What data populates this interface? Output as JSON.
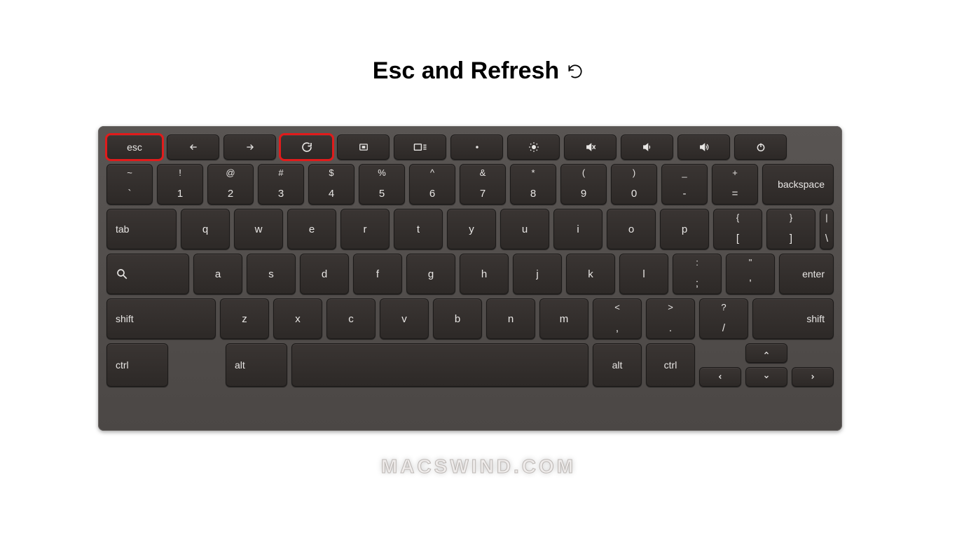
{
  "title_text": "Esc and Refresh",
  "watermark_text": "MACSWIND.COM",
  "highlighted_keys": [
    "esc",
    "refresh"
  ],
  "function_row": [
    {
      "id": "esc",
      "kind": "text",
      "label": "esc",
      "highlight": true
    },
    {
      "id": "back",
      "kind": "icon",
      "icon": "arrow-left",
      "highlight": false
    },
    {
      "id": "forward",
      "kind": "icon",
      "icon": "arrow-right",
      "highlight": false
    },
    {
      "id": "refresh",
      "kind": "icon",
      "icon": "refresh",
      "highlight": true
    },
    {
      "id": "fullscreen",
      "kind": "icon",
      "icon": "fullscreen",
      "highlight": false
    },
    {
      "id": "overview",
      "kind": "icon",
      "icon": "overview",
      "highlight": false
    },
    {
      "id": "brightness-down",
      "kind": "icon",
      "icon": "brightness-down",
      "highlight": false
    },
    {
      "id": "brightness-up",
      "kind": "icon",
      "icon": "brightness-up",
      "highlight": false
    },
    {
      "id": "mute",
      "kind": "icon",
      "icon": "mute",
      "highlight": false
    },
    {
      "id": "volume-down",
      "kind": "icon",
      "icon": "volume-down",
      "highlight": false
    },
    {
      "id": "volume-up",
      "kind": "icon",
      "icon": "volume-up",
      "highlight": false
    },
    {
      "id": "power",
      "kind": "icon",
      "icon": "power",
      "highlight": false
    }
  ],
  "number_row": [
    {
      "upper": "~",
      "lower": "`"
    },
    {
      "upper": "!",
      "lower": "1"
    },
    {
      "upper": "@",
      "lower": "2"
    },
    {
      "upper": "#",
      "lower": "3"
    },
    {
      "upper": "$",
      "lower": "4"
    },
    {
      "upper": "%",
      "lower": "5"
    },
    {
      "upper": "^",
      "lower": "6"
    },
    {
      "upper": "&",
      "lower": "7"
    },
    {
      "upper": "*",
      "lower": "8"
    },
    {
      "upper": "(",
      "lower": "9"
    },
    {
      "upper": ")",
      "lower": "0"
    },
    {
      "upper": "_",
      "lower": "-"
    },
    {
      "upper": "+",
      "lower": "="
    }
  ],
  "backspace_label": "backspace",
  "qwerty_row": {
    "tab_label": "tab",
    "letters": [
      "q",
      "w",
      "e",
      "r",
      "t",
      "y",
      "u",
      "i",
      "o",
      "p"
    ],
    "bracket_l": {
      "upper": "{",
      "lower": "["
    },
    "bracket_r": {
      "upper": "}",
      "lower": "]"
    },
    "bslash": {
      "upper": "|",
      "lower": "\\"
    }
  },
  "home_row": {
    "letters": [
      "a",
      "s",
      "d",
      "f",
      "g",
      "h",
      "j",
      "k",
      "l"
    ],
    "semicolon": {
      "upper": ":",
      "lower": ";"
    },
    "quote": {
      "upper": "\"",
      "lower": "'"
    },
    "enter_label": "enter"
  },
  "shift_row": {
    "lshift_label": "shift",
    "letters": [
      "z",
      "x",
      "c",
      "v",
      "b",
      "n",
      "m"
    ],
    "comma": {
      "upper": "<",
      "lower": ","
    },
    "period": {
      "upper": ">",
      "lower": "."
    },
    "slash": {
      "upper": "?",
      "lower": "/"
    },
    "rshift_label": "shift"
  },
  "bottom_row": {
    "ctrl_l": "ctrl",
    "alt_l": "alt",
    "alt_r": "alt",
    "ctrl_r": "ctrl"
  },
  "arrows": {
    "up": "⌃",
    "down": "⌄",
    "left": "<",
    "right": ">"
  }
}
